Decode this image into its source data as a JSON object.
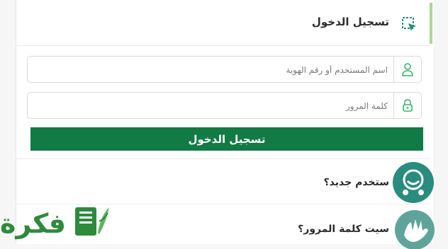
{
  "header": {
    "title": "تسجيل الدخول"
  },
  "fields": {
    "username_placeholder": "اسم المستخدم أو رقم الهوية",
    "password_placeholder": "كلمة المرور"
  },
  "login_button": "تسجيل الدخول",
  "new_user": {
    "label": "ستخدم جديد؟"
  },
  "forgot_password": {
    "label": "سيت كلمة المرور؟"
  },
  "watermark": {
    "text": "فكرة"
  },
  "colors": {
    "brand_green": "#127a45",
    "accent_bar": "#a8d89a",
    "teal_icon": "#2a8c7e",
    "logo_green": "#2e8a3c"
  }
}
